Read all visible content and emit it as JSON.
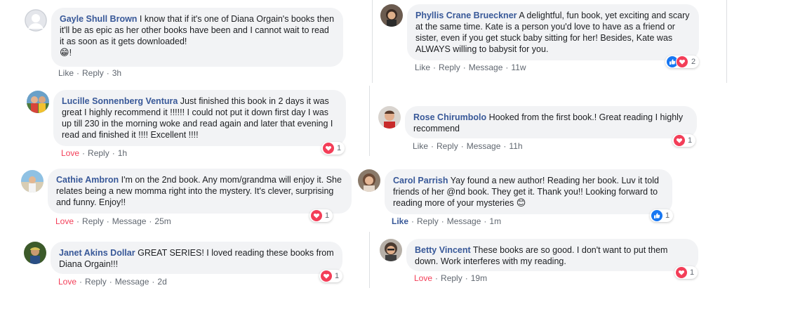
{
  "colors": {
    "author": "#385898",
    "love": "#f33e58",
    "like_blue": "#1877f2",
    "bubble_bg": "#f2f3f5",
    "meta": "#606770"
  },
  "left_comments": [
    {
      "author": "Gayle Shull Brown",
      "text": "I know that if it's one of Diana Orgain's books then it'll be as epic as her other books have been and I cannot wait to read it as soon as it gets downloaded!",
      "text_line2": "!",
      "emoji": "😁",
      "actions": {
        "primary": "Like",
        "reply": "Reply",
        "time": "3h"
      }
    },
    {
      "author": "Lucille Sonnenberg Ventura",
      "text": "Just finished this book in 2 days it was great I highly recommend it !!!!!! I could not put it down first day I was up till 230 in the morning woke and read again and later that evening I read and finished it !!!! Excellent !!!!",
      "actions": {
        "primary": "Love",
        "reply": "Reply",
        "time": "1h"
      },
      "reactions": {
        "icons": [
          "heart-icon"
        ],
        "count": "1"
      }
    },
    {
      "author": "Cathie Ambron",
      "text": "I'm on the 2nd book. Any mom/grandma will enjoy it. She relates being a new momma right into the mystery. It's clever, surprising and funny. Enjoy!!",
      "actions": {
        "primary": "Love",
        "reply": "Reply",
        "message": "Message",
        "time": "25m"
      },
      "reactions": {
        "icons": [
          "heart-icon"
        ],
        "count": "1"
      }
    },
    {
      "author": "Janet Akins Dollar",
      "text": "GREAT SERIES! I loved reading these books from Diana Orgain!!!",
      "actions": {
        "primary": "Love",
        "reply": "Reply",
        "message": "Message",
        "time": "2d"
      },
      "reactions": {
        "icons": [
          "heart-icon"
        ],
        "count": "1"
      }
    }
  ],
  "right_comments": [
    {
      "author": "Phyllis Crane Brueckner",
      "text": "A delightful, fun book, yet exciting and scary at the same time. Kate is a person you'd love to have as a friend or sister, even if you get stuck baby sitting for her! Besides, Kate was ALWAYS willing to babysit for you.",
      "actions": {
        "primary": "Like",
        "reply": "Reply",
        "message": "Message",
        "time": "11w"
      },
      "reactions": {
        "icons": [
          "like-icon",
          "heart-icon"
        ],
        "count": "2"
      }
    },
    {
      "author": "Rose Chirumbolo",
      "text": "Hooked from the first book.! Great reading I highly recommend",
      "actions": {
        "primary": "Like",
        "reply": "Reply",
        "message": "Message",
        "time": "11h"
      },
      "reactions": {
        "icons": [
          "heart-icon"
        ],
        "count": "1"
      }
    },
    {
      "author": "Carol Parrish",
      "text": "Yay found a new author! Reading her book. Luv it told friends of her @nd book. They get it. Thank you!! Looking forward to reading more of your mysteries",
      "emoji": "😊",
      "actions": {
        "primary": "Like",
        "reply": "Reply",
        "message": "Message",
        "time": "1m"
      },
      "reactions": {
        "icons": [
          "like-icon"
        ],
        "count": "1"
      }
    },
    {
      "author": "Betty Vincent",
      "text": "These books are so good. I don't want to put them down. Work interferes with my reading.",
      "actions": {
        "primary": "Love",
        "reply": "Reply",
        "time": "19m"
      },
      "reactions": {
        "icons": [
          "heart-icon"
        ],
        "count": "1"
      }
    }
  ]
}
